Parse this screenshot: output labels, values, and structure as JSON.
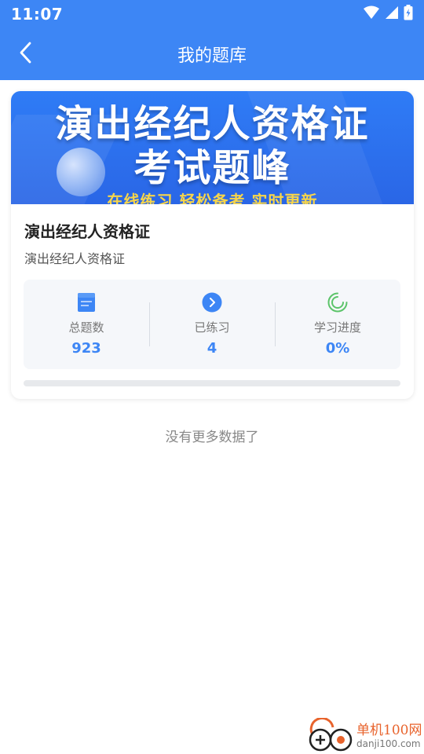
{
  "status_bar": {
    "time": "11:07",
    "icons": [
      "wifi-icon",
      "signal-icon",
      "battery-charging-icon"
    ]
  },
  "nav": {
    "title": "我的题库",
    "back_icon": "chevron-left-icon"
  },
  "card": {
    "banner": {
      "line1": "演出经纪人资格证",
      "line2": "考试题峰",
      "line3": "在线练习 轻松备考 实时更新"
    },
    "title": "演出经纪人资格证",
    "subtitle": "演出经纪人资格证",
    "stats": [
      {
        "icon": "book-icon",
        "label": "总题数",
        "value": "923"
      },
      {
        "icon": "arrow-circle-icon",
        "label": "已练习",
        "value": "4"
      },
      {
        "icon": "progress-ring-icon",
        "label": "学习进度",
        "value": "0%"
      }
    ],
    "progress_fraction": 0
  },
  "footer_text": "没有更多数据了",
  "watermark": {
    "cn": "单机100网",
    "url": "danji100.com"
  },
  "colors": {
    "primary": "#3d86f5",
    "banner_slogan": "#f7d54a",
    "watermark": "#e8632c"
  }
}
